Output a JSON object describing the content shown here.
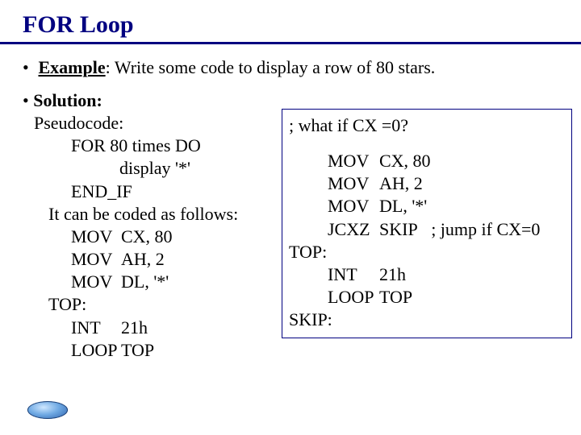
{
  "title": "FOR Loop",
  "example": {
    "label": "Example",
    "text": ": Write some code to display a row of 80 stars."
  },
  "solution": {
    "label": "Solution:",
    "pseudo_heading": "Pseudocode:",
    "pseudo_lines": {
      "for": "FOR 80 times DO",
      "display": "display '*'",
      "endif": "END_IF"
    },
    "coded_as": "It can be coded as follows:",
    "code": {
      "l1_mn": "MOV",
      "l1_op": "CX, 80",
      "l2_mn": "MOV",
      "l2_op": "AH, 2",
      "l3_mn": "MOV",
      "l3_op": "DL, '*'",
      "top_label": "TOP:",
      "l4_mn": "INT",
      "l4_op": "21h",
      "l5_mn": "LOOP",
      "l5_op": "TOP"
    }
  },
  "box": {
    "question": "; what if CX =0?",
    "code": {
      "l1_mn": "MOV",
      "l1_op": "CX, 80",
      "l2_mn": "MOV",
      "l2_op": "AH, 2",
      "l3_mn": "MOV",
      "l3_op": "DL, '*'",
      "l4_mn": "JCXZ",
      "l4_op": "SKIP",
      "l4_cmt": "; jump if CX=0",
      "top_label": "TOP:",
      "l5_mn": "INT",
      "l5_op": "21h",
      "l6_mn": "LOOP",
      "l6_op": "TOP",
      "skip_label": "SKIP:"
    }
  }
}
